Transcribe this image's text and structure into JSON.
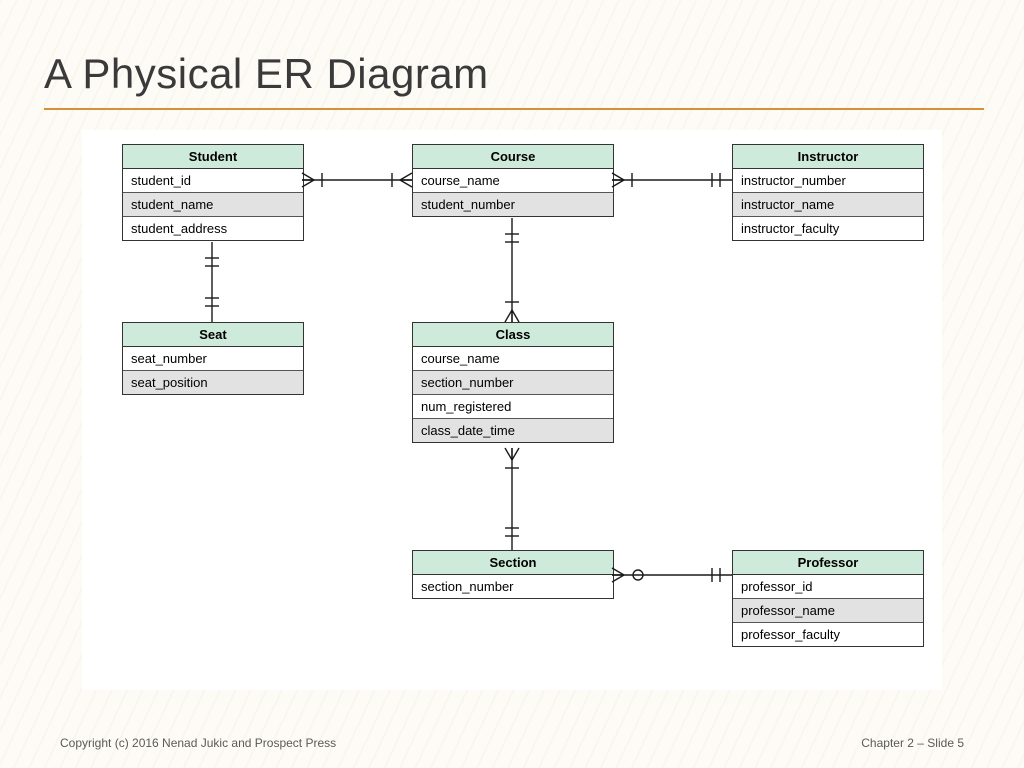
{
  "title": "A Physical ER Diagram",
  "footer": {
    "left": "Copyright (c) 2016 Nenad Jukic and Prospect Press",
    "right": "Chapter 2 – Slide  5"
  },
  "entities": {
    "student": {
      "name": "Student",
      "rows": [
        {
          "label": "student_id",
          "shade": false
        },
        {
          "label": "student_name",
          "shade": true
        },
        {
          "label": "student_address",
          "shade": false
        }
      ]
    },
    "course": {
      "name": "Course",
      "rows": [
        {
          "label": "course_name",
          "shade": false
        },
        {
          "label": "student_number",
          "shade": true
        }
      ]
    },
    "instructor": {
      "name": "Instructor",
      "rows": [
        {
          "label": "instructor_number",
          "shade": false
        },
        {
          "label": "instructor_name",
          "shade": true
        },
        {
          "label": "instructor_faculty",
          "shade": false
        }
      ]
    },
    "seat": {
      "name": "Seat",
      "rows": [
        {
          "label": "seat_number",
          "shade": false
        },
        {
          "label": "seat_position",
          "shade": true
        }
      ]
    },
    "class": {
      "name": "Class",
      "rows": [
        {
          "label": "course_name",
          "shade": false
        },
        {
          "label": "section_number",
          "shade": true
        },
        {
          "label": "num_registered",
          "shade": false
        },
        {
          "label": "class_date_time",
          "shade": true
        }
      ]
    },
    "section": {
      "name": "Section",
      "rows": [
        {
          "label": "section_number",
          "shade": false
        }
      ]
    },
    "professor": {
      "name": "Professor",
      "rows": [
        {
          "label": "professor_id",
          "shade": false
        },
        {
          "label": "professor_name",
          "shade": true
        },
        {
          "label": "professor_faculty",
          "shade": false
        }
      ]
    }
  }
}
